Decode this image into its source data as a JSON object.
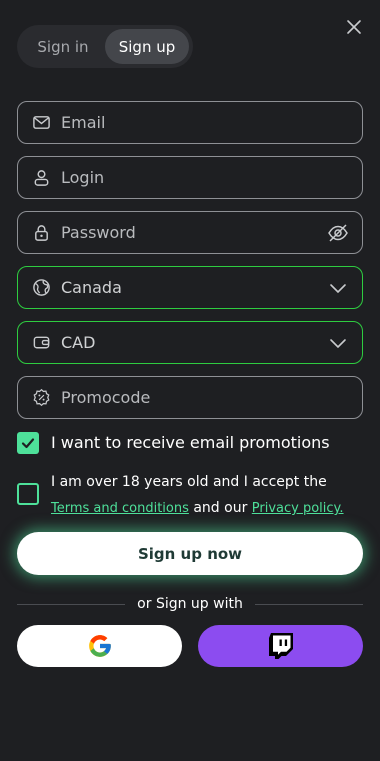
{
  "tabs": {
    "signin": "Sign in",
    "signup": "Sign up",
    "active": "signup"
  },
  "form": {
    "email": {
      "placeholder": "Email",
      "icon": "mail-icon"
    },
    "login": {
      "placeholder": "Login",
      "icon": "user-icon"
    },
    "password": {
      "placeholder": "Password",
      "icon": "lock-icon",
      "toggle_icon": "eye-off-icon"
    },
    "country": {
      "value": "Canada",
      "icon": "globe-icon"
    },
    "currency": {
      "value": "CAD",
      "icon": "wallet-icon"
    },
    "promocode": {
      "placeholder": "Promocode",
      "icon": "gear-badge-icon"
    }
  },
  "checkboxes": {
    "promotions": {
      "label": "I want to receive email promotions",
      "checked": true
    },
    "terms": {
      "checked": false,
      "text_before": "I am over 18 years old and I accept the ",
      "terms_link": "Terms and conditions",
      "text_middle": " and our ",
      "privacy_link": "Privacy policy."
    }
  },
  "submit_label": "Sign up now",
  "social_divider": "or Sign up with",
  "social": {
    "google_icon": "google-icon",
    "twitch_icon": "twitch-icon"
  },
  "colors": {
    "accent": "#4ee09a",
    "valid_border": "#2ecc40",
    "twitch": "#8c4cf0",
    "background": "#1e1f22"
  }
}
